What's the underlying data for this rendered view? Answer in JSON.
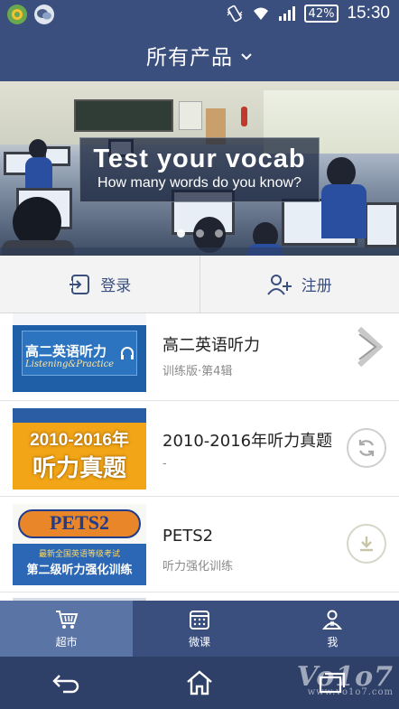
{
  "status_bar": {
    "battery": "42%",
    "time": "15:30"
  },
  "header": {
    "title": "所有产品"
  },
  "banner": {
    "title": "Test your vocab",
    "subtitle": "How many words do you know?",
    "page_count": 3,
    "active_page": 0
  },
  "auth": {
    "login_label": "登录",
    "register_label": "注册"
  },
  "products": [
    {
      "cover_title": "高二英语听力",
      "cover_subtitle": "Listening&Practice",
      "title": "高二英语听力",
      "subtitle": "训练版·第4辑",
      "action_icon": "chevron-right-icon"
    },
    {
      "cover_title_line1": "2010-2016年",
      "cover_title_line2": "听力真题",
      "title": "2010-2016年听力真题",
      "subtitle": "-",
      "action_icon": "refresh-icon"
    },
    {
      "cover_title_line1": "PETS2",
      "cover_title_line2": "最新全国英语等级考试",
      "cover_title_line3": "第二级听力强化训练",
      "title": "PETS2",
      "subtitle": "听力强化训练",
      "action_icon": "download-icon"
    }
  ],
  "tabs": [
    {
      "label": "超市",
      "icon": "cart-icon",
      "active": true
    },
    {
      "label": "微课",
      "icon": "calendar-grid-icon",
      "active": false
    },
    {
      "label": "我",
      "icon": "user-icon",
      "active": false
    }
  ],
  "watermark": {
    "text": "Vo1o7",
    "sub": "www.vo1o7.com"
  },
  "colors": {
    "primary": "#3b4f7e",
    "tab_active": "#5b74a6",
    "nav": "#2e3f68"
  }
}
